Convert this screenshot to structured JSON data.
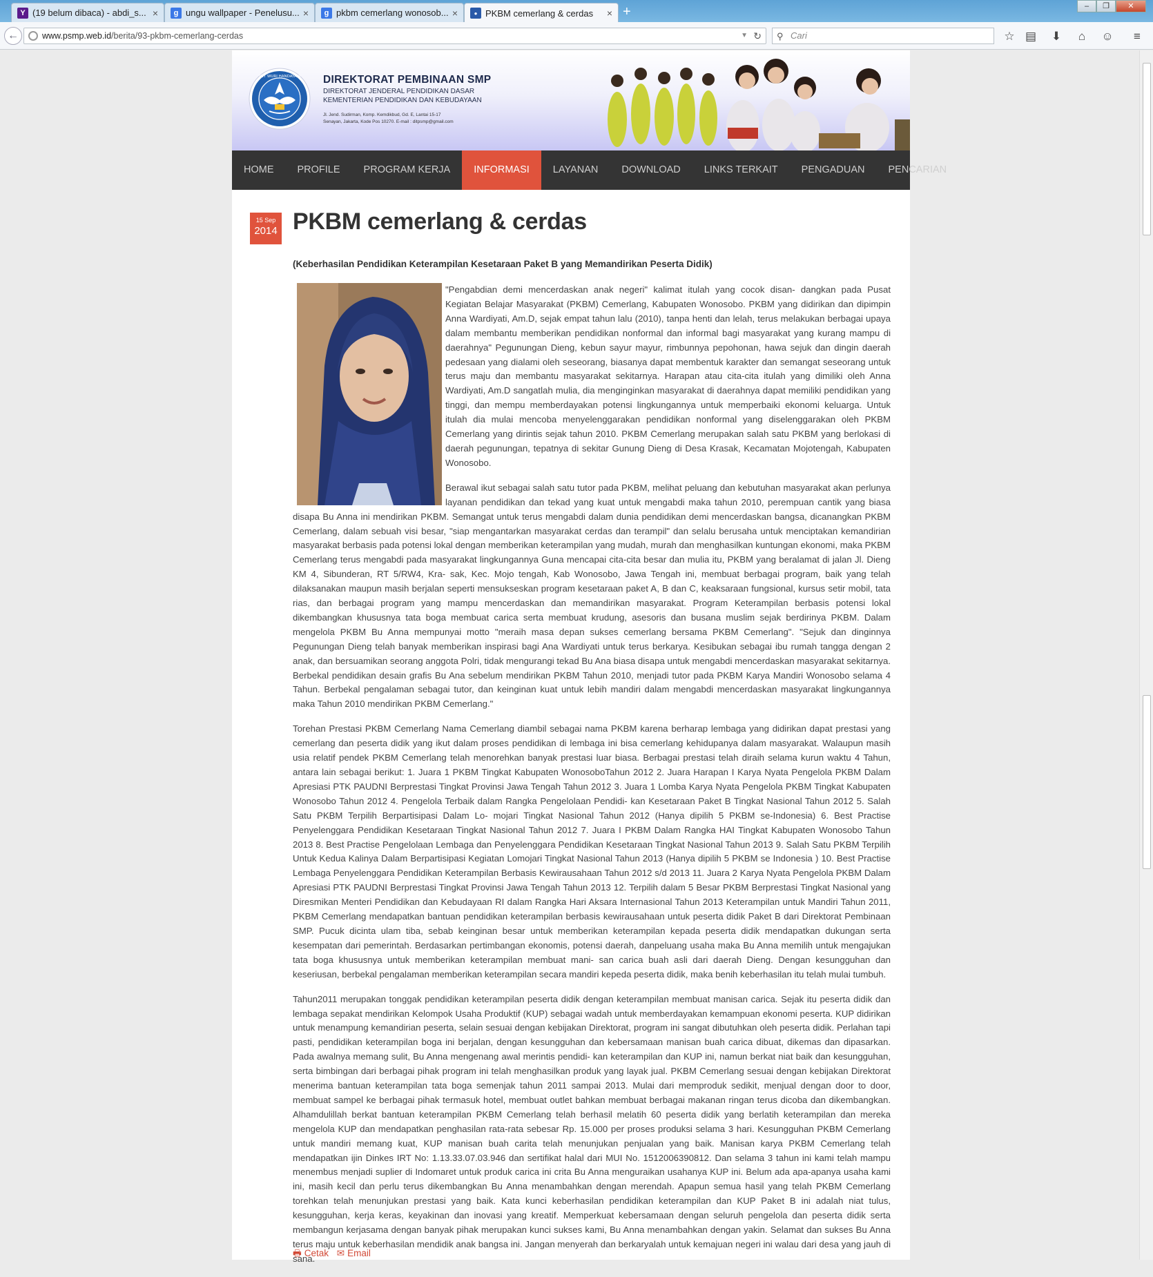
{
  "browser": {
    "tabs": [
      {
        "title": "(19 belum dibaca) - abdi_s...",
        "icon": "yahoo-icon",
        "color": "#5b1b8c",
        "glyph": "Y"
      },
      {
        "title": "ungu wallpaper - Penelusu...",
        "icon": "google-icon",
        "color": "#3b78e7",
        "glyph": "g"
      },
      {
        "title": "pkbm cemerlang wonosob...",
        "icon": "google-icon",
        "color": "#3b78e7",
        "glyph": "g"
      },
      {
        "title": "PKBM cemerlang & cerdas",
        "icon": "site-icon",
        "color": "#2a5aa8",
        "glyph": "●"
      }
    ],
    "new_tab": "+",
    "url_host": "www.psmp.web.id",
    "url_path": "/berita/93-pkbm-cemerlang-cerdas",
    "search_placeholder": "Cari"
  },
  "header": {
    "org_name": "DIREKTORAT PEMBINAAN SMP",
    "org_sub1": "DIREKTORAT JENDERAL PENDIDIKAN DASAR",
    "org_sub2": "KEMENTERIAN PENDIDIKAN DAN KEBUDAYAAN",
    "address1": "Jl. Jend. Sudirman, Komp. Kemdikbud, Gd. E, Lantai 15-17",
    "address2": "Senayan, Jakarta, Kode Pos 10270. E-mail : ditpsmp@gmail.com",
    "logo_motto": "TUT WURI HANDAYANI"
  },
  "nav": [
    "HOME",
    "PROFILE",
    "PROGRAM KERJA",
    "INFORMASI",
    "LAYANAN",
    "DOWNLOAD",
    "LINKS TERKAIT",
    "PENGADUAN",
    "PENCARIAN"
  ],
  "nav_active": "INFORMASI",
  "accent": "#e0533c",
  "article": {
    "date_daymonth": "15 Sep",
    "date_year": "2014",
    "title": "PKBM cemerlang & cerdas",
    "subtitle": "(Keberhasilan Pendidikan Keterampilan Kesetaraan Paket B yang Memandirikan Peserta Didik)",
    "paragraphs": [
      "\"Pengabdian demi mencerdaskan anak negeri\" kalimat itulah yang cocok disan- dangkan pada Pusat Kegiatan Belajar Masyarakat (PKBM) Cemerlang, Kabupaten Wonosobo. PKBM yang didirikan dan dipimpin Anna Wardiyati, Am.D, sejak empat tahun lalu (2010), tanpa henti dan lelah, terus melakukan berbagai upaya dalam membantu memberikan pendidikan nonformal dan informal bagi masyarakat yang kurang mampu di daerahnya\" Pegunungan Dieng, kebun sayur mayur, rimbunnya pepohonan, hawa sejuk dan dingin daerah pedesaan yang dialami oleh seseorang, biasanya dapat membentuk karakter dan semangat seseorang untuk terus maju dan membantu masyarakat sekitarnya. Harapan atau cita-cita itulah yang dimiliki oleh Anna Wardiyati, Am.D sangatlah mulia, dia menginginkan masyarakat di daerahnya dapat memiliki pendidikan yang tinggi, dan mempu memberdayakan potensi lingkungannya untuk memperbaiki ekonomi keluarga. Untuk itulah dia mulai mencoba menyelenggarakan pendidikan nonformal yang diselenggarakan oleh PKBM Cemerlang yang dirintis sejak tahun 2010. PKBM Cemerlang merupakan salah satu PKBM yang berlokasi di daerah pegunungan, tepatnya di sekitar Gunung Dieng di Desa Krasak, Kecamatan Mojotengah, Kabupaten Wonosobo.",
      "Berawal ikut sebagai salah satu tutor pada PKBM, melihat peluang dan kebutuhan masyarakat akan perlunya layanan pendidikan dan tekad yang kuat untuk mengabdi maka tahun 2010, perempuan cantik yang biasa disapa Bu Anna ini mendirikan PKBM. Semangat untuk terus mengabdi dalam dunia pendidikan demi mencerdaskan bangsa, dicanangkan PKBM Cemerlang, dalam sebuah visi besar, \"siap mengantarkan masyarakat cerdas dan terampil\" dan selalu berusaha untuk menciptakan kemandirian masyarakat berbasis pada potensi lokal dengan memberikan keterampilan yang mudah, murah dan menghasilkan kuntungan ekonomi, maka PKBM Cemerlang terus mengabdi pada masyarakat lingkungannya Guna mencapai cita-cita besar dan mulia itu, PKBM yang beralamat di jalan Jl. Dieng KM 4, Sibunderan, RT 5/RW4, Kra- sak, Kec. Mojo tengah, Kab Wonosobo, Jawa Tengah ini, membuat berbagai program, baik yang telah dilaksanakan maupun masih berjalan seperti mensukseskan program kesetaraan paket A, B dan C, keaksaraan fungsional, kursus setir mobil, tata rias, dan berbagai program yang mampu mencerdaskan dan memandirikan masyarakat. Program Keterampilan berbasis potensi lokal dikembangkan khususnya tata boga membuat carica serta membuat krudung, asesoris dan busana muslim sejak berdirinya PKBM. Dalam mengelola PKBM Bu Anna mempunyai motto \"meraih masa depan sukses cemerlang bersama PKBM Cemerlang\". \"Sejuk dan dinginnya Pegunungan Dieng telah banyak memberikan inspirasi bagi Ana Wardiyati untuk terus berkarya. Kesibukan sebagai ibu rumah tangga dengan 2 anak, dan bersuamikan seorang anggota Polri, tidak mengurangi tekad Bu Ana biasa disapa untuk mengabdi mencerdaskan masyarakat sekitarnya. Berbekal pendidikan desain grafis Bu Ana sebelum mendirikan PKBM Tahun 2010, menjadi tutor pada PKBM Karya Mandiri Wonosobo selama 4 Tahun. Berbekal pengalaman sebagai tutor, dan keinginan kuat untuk lebih mandiri dalam mengabdi mencerdaskan masyarakat lingkungannya maka Tahun 2010 mendirikan PKBM Cemerlang.\"",
      "Torehan Prestasi PKBM Cemerlang Nama Cemerlang diambil sebagai nama PKBM karena berharap lembaga yang didirikan dapat prestasi yang cemerlang dan peserta didik yang ikut dalam proses pendidikan di lembaga ini bisa cemerlang kehidupanya dalam masyarakat. Walaupun masih usia relatif pendek PKBM Cemerlang telah menorehkan banyak prestasi luar biasa. Berbagai prestasi telah diraih selama kurun waktu 4 Tahun, antara lain sebagai berikut: 1. Juara 1 PKBM Tingkat Kabupaten WonosoboTahun 2012 2. Juara Harapan I Karya Nyata Pengelola PKBM Dalam Apresiasi PTK PAUDNI Berprestasi Tingkat Provinsi Jawa Tengah Tahun 2012 3. Juara 1 Lomba Karya Nyata Pengelola PKBM Tingkat Kabupaten Wonosobo Tahun 2012 4. Pengelola Terbaik dalam Rangka Pengelolaan Pendidi- kan Kesetaraan Paket B Tingkat Nasional Tahun 2012 5. Salah Satu PKBM Terpilih Berpartisipasi Dalam Lo- mojari Tingkat Nasional Tahun 2012 (Hanya dipilih 5 PKBM se-Indonesia) 6. Best Practise Penyelenggara Pendidikan Kesetaraan Tingkat Nasional Tahun 2012 7. Juara I PKBM Dalam Rangka HAI Tingkat Kabupaten Wonosobo Tahun 2013 8. Best Practise Pengelolaan Lembaga dan Penyelenggara Pendidikan Kesetaraan Tingkat Nasional Tahun 2013 9. Salah Satu PKBM Terpilih Untuk Kedua Kalinya Dalam Berpartisipasi Kegiatan Lomojari Tingkat Nasional Tahun 2013 (Hanya dipilih 5 PKBM se Indonesia ) 10. Best Practise Lembaga Penyelenggara Pendidikan Keterampilan Berbasis Kewirausahaan Tahun 2012 s/d 2013 11. Juara 2 Karya Nyata Pengelola PKBM Dalam Apresiasi PTK PAUDNI Berprestasi Tingkat Provinsi Jawa Tengah Tahun 2013 12. Terpilih dalam 5 Besar PKBM Berprestasi Tingkat Nasional yang Diresmikan Menteri Pendidikan dan Kebudayaan RI dalam Rangka Hari Aksara Internasional Tahun 2013 Keterampilan untuk Mandiri Tahun 2011, PKBM Cemerlang mendapatkan bantuan pendidikan keterampilan berbasis kewirausahaan untuk peserta didik Paket B dari Direktorat Pembinaan SMP. Pucuk dicinta ulam tiba, sebab keinginan besar untuk memberikan keterampilan kepada peserta didik mendapatkan dukungan serta kesempatan dari pemerintah. Berdasarkan pertimbangan ekonomis, potensi daerah, danpeluang usaha maka Bu Anna memilih untuk mengajukan tata boga khususnya untuk memberikan keterampilan membuat mani- san carica buah asli dari daerah Dieng. Dengan kesungguhan dan keseriusan, berbekal pengalaman memberikan keterampilan secara mandiri kepeda peserta didik, maka benih keberhasilan itu telah mulai tumbuh.",
      "Tahun2011 merupakan tonggak pendidikan keterampilan peserta didik dengan keterampilan membuat manisan carica. Sejak itu peserta didik dan lembaga sepakat mendirikan Kelompok Usaha Produktif (KUP) sebagai wadah untuk memberdayakan kemampuan ekonomi peserta. KUP didirikan untuk menampung kemandirian peserta, selain sesuai dengan kebijakan Direktorat, program ini sangat dibutuhkan oleh peserta didik. Perlahan tapi pasti, pendidikan keterampilan boga ini berjalan, dengan kesungguhan dan kebersamaan manisan buah carica dibuat, dikemas dan dipasarkan. Pada awalnya memang sulit, Bu Anna mengenang awal merintis pendidi- kan keterampilan dan KUP ini, namun berkat niat baik dan kesungguhan, serta bimbingan dari berbagai pihak program ini telah menghasilkan produk yang layak jual. PKBM Cemerlang sesuai dengan kebijakan Direktorat menerima bantuan keterampilan tata boga semenjak tahun 2011 sampai 2013. Mulai dari memproduk sedikit, menjual dengan door to door, membuat sampel ke berbagai pihak termasuk hotel, membuat outlet bahkan membuat berbagai makanan ringan terus dicoba dan dikembangkan. Alhamdulillah berkat bantuan keterampilan PKBM Cemerlang telah berhasil melatih 60 peserta didik yang berlatih keterampilan dan mereka mengelola KUP dan mendapatkan penghasilan rata-rata sebesar Rp. 15.000 per proses produksi selama 3 hari. Kesungguhan PKBM Cemerlang untuk mandiri memang kuat, KUP manisan buah carita telah menunjukan penjualan yang baik. Manisan karya PKBM Cemerlang telah mendapatkan ijin Dinkes IRT No: 1.13.33.07.03.946 dan sertifikat halal dari MUI No. 1512006390812. Dan selama 3 tahun ini kami telah mampu menembus menjadi suplier di Indomaret untuk produk carica ini crita Bu Anna menguraikan usahanya KUP ini. Belum ada apa-apanya usaha kami ini, masih kecil dan perlu terus dikembangkan Bu Anna menambahkan dengan merendah. Apapun semua hasil yang telah PKBM Cemerlang torehkan telah menunjukan prestasi yang baik. Kata kunci keberhasilan pendidikan keterampilan dan KUP Paket B ini adalah niat tulus, kesungguhan, kerja keras, keyakinan dan inovasi yang kreatif. Memperkuat kebersamaan dengan seluruh pengelola dan peserta didik serta membangun kerjasama dengan banyak pihak merupakan kunci sukses kami, Bu Anna menambahkan dengan yakin. Selamat dan sukses Bu Anna terus maju untuk keberhasilan mendidik anak bangsa ini. Jangan menyerah dan berkaryalah untuk kemajuan negeri ini walau dari desa yang jauh di sana."
    ],
    "print_label": "Cetak",
    "email_label": "Email"
  }
}
